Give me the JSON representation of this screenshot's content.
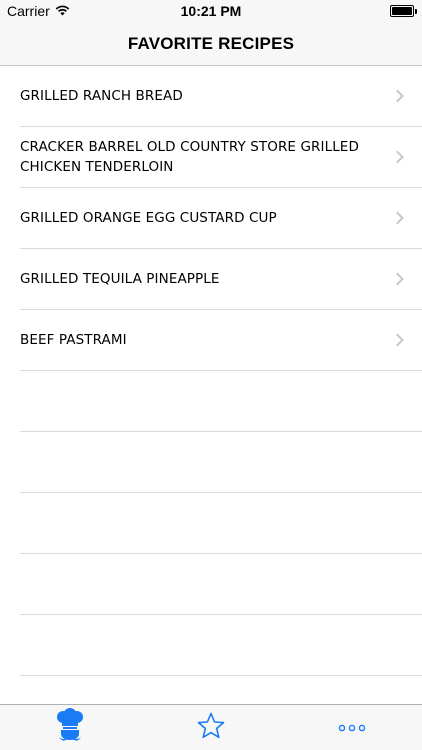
{
  "status_bar": {
    "carrier": "Carrier",
    "time": "10:21 PM",
    "wifi_icon": "wifi-icon",
    "battery_icon": "battery-icon"
  },
  "nav": {
    "title": "FAVORITE RECIPES"
  },
  "recipes": [
    {
      "label": "GRILLED RANCH BREAD"
    },
    {
      "label": "CRACKER BARREL OLD COUNTRY STORE GRILLED CHICKEN TENDERLOIN"
    },
    {
      "label": "GRILLED ORANGE EGG CUSTARD CUP"
    },
    {
      "label": "GRILLED TEQUILA PINEAPPLE"
    },
    {
      "label": "BEEF PASTRAMI"
    }
  ],
  "tab_bar": {
    "tabs": [
      {
        "icon": "chef-icon",
        "selected": true
      },
      {
        "icon": "star-icon",
        "selected": false
      },
      {
        "icon": "more-icon",
        "selected": false
      }
    ],
    "accent_color": "#1a7cf5"
  }
}
